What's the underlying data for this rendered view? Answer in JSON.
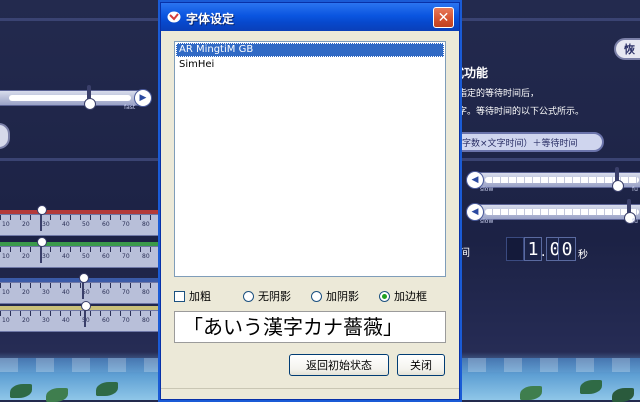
{
  "dialog": {
    "title": "字体设定",
    "close_label": "✕",
    "fonts": [
      "AR MingtiM GB",
      "SimHei"
    ],
    "selected_font_index": 0,
    "options": {
      "bold_label": "加粗",
      "bold_checked": false,
      "shadow_none": "无阴影",
      "shadow_add": "加阴影",
      "border_add": "加边框",
      "selected_effect": "border_add"
    },
    "preview_text": "「あいう漢字カナ薔薇」",
    "reset_button": "返回初始状态",
    "close_button": "关闭"
  },
  "background": {
    "top_button": "恢",
    "feature_title": "式功能",
    "desc_line1": "指定的等待时间后，",
    "desc_line2": "字。等待时间的以下公式所示。",
    "formula": "字数×文字时间）＋等待时间",
    "slider_slow": "slow",
    "slider_fast_a": "fast",
    "slider_fast_b": "fu",
    "slider_fast_c": "fu",
    "time_label": "间",
    "time_digit1": "1",
    "time_dot": ".",
    "time_digit2": "0",
    "time_digit3": "0",
    "time_unit": "秒",
    "scale_numbers": [
      "10",
      "20",
      "30",
      "40",
      "50",
      "60",
      "70",
      "80"
    ],
    "scale_positions": [
      0.4,
      0.4,
      0.7,
      0.7
    ]
  },
  "colors": {
    "accent": "#0a55e0",
    "selection": "#316ac5",
    "close": "#d4512e",
    "radio_dot": "#21a121"
  }
}
